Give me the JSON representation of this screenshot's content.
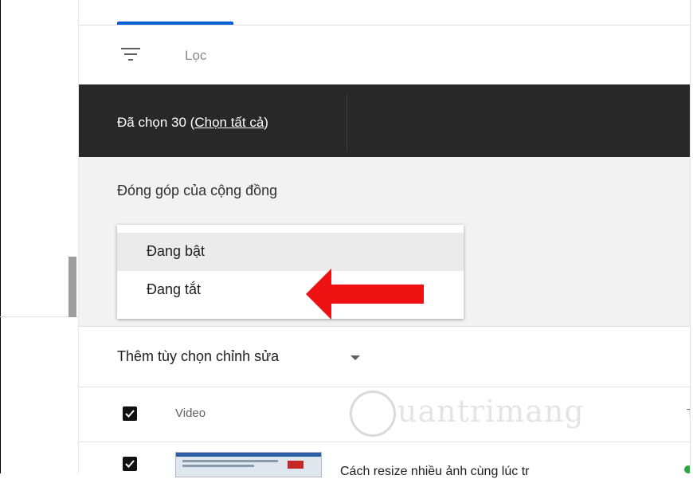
{
  "filter": {
    "icon": "filter-list-icon",
    "label": "Lọc"
  },
  "selection": {
    "prefix": "Đã chọn 30 (",
    "select_all_link": "Chọn tất cả",
    "suffix": ")"
  },
  "community_panel": {
    "title": "Đóng góp của cộng đồng",
    "options": [
      {
        "label": "Đang bật",
        "highlighted": true
      },
      {
        "label": "Đang tắt",
        "highlighted": false
      }
    ],
    "arrow_color": "#ee1111"
  },
  "more_options": {
    "label": "Thêm tùy chọn chỉnh sửa",
    "icon": "caret-down-icon"
  },
  "table": {
    "header": {
      "video_col": "Video",
      "next_col": "T",
      "select_all_checked": true
    },
    "rows": [
      {
        "title": "Cách resize nhiều ảnh cùng lúc tr",
        "checked": true,
        "status_color": "#2ba640"
      }
    ]
  },
  "watermark": {
    "text": "uantrimang"
  },
  "colors": {
    "accent": "#065fd4",
    "dark_bar": "#282828",
    "panel_bg": "#f2f2f2"
  }
}
